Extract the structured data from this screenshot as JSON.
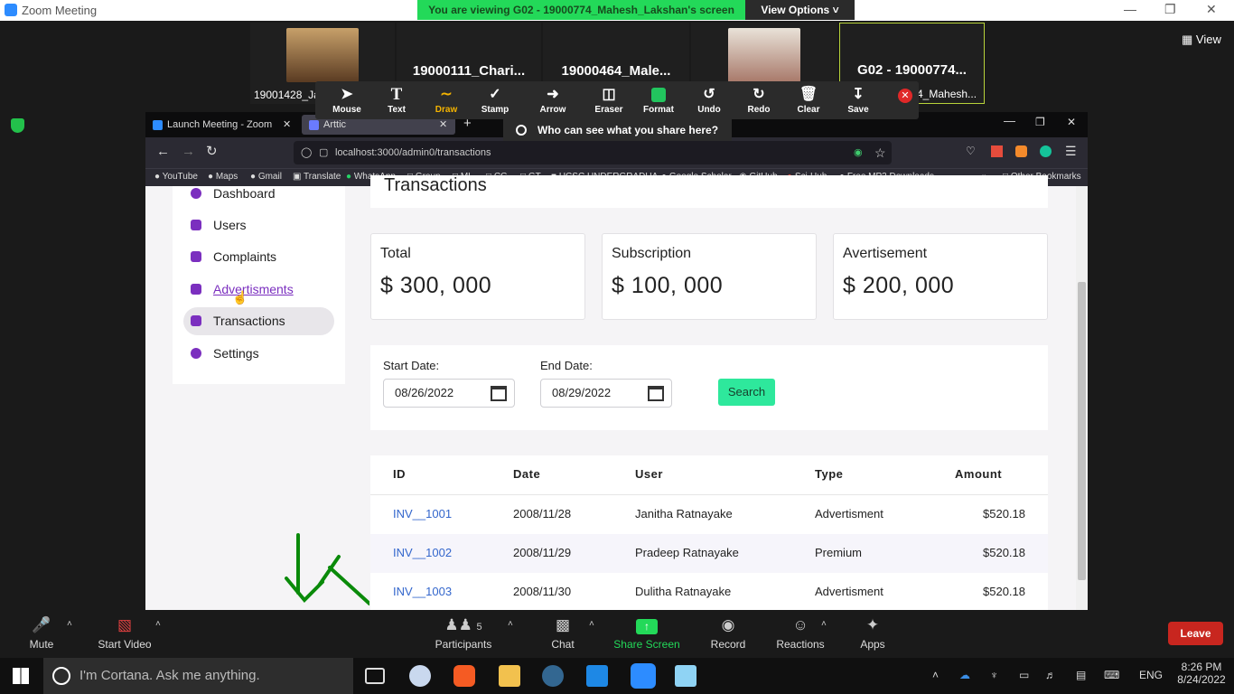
{
  "zoom": {
    "window_title": "Zoom Meeting",
    "viewing_banner": "You are viewing G02 - 19000774_Mahesh_Lakshan's screen",
    "view_options": "View Options",
    "view_label": "View",
    "participants_tiles": [
      {
        "name": "19001428_Ja"
      },
      {
        "name": "19000111_Chari..."
      },
      {
        "name": "19000464_Male..."
      },
      {
        "name": ""
      },
      {
        "name": "G02 - 19000774..."
      }
    ],
    "shared_name_suffix": "4_Mahesh...",
    "annotation_tools": [
      "Mouse",
      "Text",
      "Draw",
      "Stamp",
      "Arrow",
      "Eraser",
      "Format",
      "Undo",
      "Redo",
      "Clear",
      "Save"
    ],
    "who_can_see": "Who can see what you share here?",
    "bottom_bar": {
      "mute": "Mute",
      "start_video": "Start Video",
      "participants": "Participants",
      "participants_count": "5",
      "chat": "Chat",
      "share_screen": "Share Screen",
      "record": "Record",
      "reactions": "Reactions",
      "apps": "Apps",
      "leave": "Leave"
    }
  },
  "browser": {
    "tabs": [
      {
        "title": "Launch Meeting - Zoom"
      },
      {
        "title": "Arttic"
      }
    ],
    "url": "localhost:3000/admin0/transactions",
    "bookmarks": [
      "YouTube",
      "Maps",
      "Gmail",
      "Translate",
      "WhatsApp",
      "Group",
      "ML",
      "CG",
      "GT",
      "UCSC UNDERGRADUA...",
      "Google Scholar",
      "GitHub",
      "Sci-Hub",
      "Free MP3 Downloads"
    ],
    "other_bookmarks": "Other Bookmarks"
  },
  "app": {
    "page_heading": "Transactions",
    "sidebar": [
      {
        "label": "Dashboard"
      },
      {
        "label": "Users"
      },
      {
        "label": "Complaints"
      },
      {
        "label": "Advertisments"
      },
      {
        "label": "Transactions"
      },
      {
        "label": "Settings"
      }
    ],
    "cards": [
      {
        "label": "Total",
        "value": "$ 300, 000"
      },
      {
        "label": "Subscription",
        "value": "$ 100, 000"
      },
      {
        "label": "Avertisement",
        "value": "$ 200, 000"
      }
    ],
    "filter": {
      "start_label": "Start Date:",
      "start_value": "08/26/2022",
      "end_label": "End Date:",
      "end_value": "08/29/2022",
      "search_label": "Search"
    },
    "table": {
      "headers": [
        "ID",
        "Date",
        "User",
        "Type",
        "Amount"
      ],
      "rows": [
        {
          "id": "INV__1001",
          "date": "2008/11/28",
          "user": "Janitha Ratnayake",
          "type": "Advertisment",
          "amount": "$520.18"
        },
        {
          "id": "INV__1002",
          "date": "2008/11/29",
          "user": "Pradeep Ratnayake",
          "type": "Premium",
          "amount": "$520.18"
        },
        {
          "id": "INV__1003",
          "date": "2008/11/30",
          "user": "Dulitha Ratnayake",
          "type": "Advertisment",
          "amount": "$520.18"
        }
      ]
    }
  },
  "taskbar": {
    "cortana": "I'm Cortana. Ask me anything.",
    "lang": "ENG",
    "time": "8:26 PM",
    "date": "8/24/2022"
  },
  "colors": {
    "accent_purple": "#7b2fbf",
    "search_green": "#2ee89c",
    "leave_red": "#c8261f",
    "zoom_green": "#23d959"
  }
}
